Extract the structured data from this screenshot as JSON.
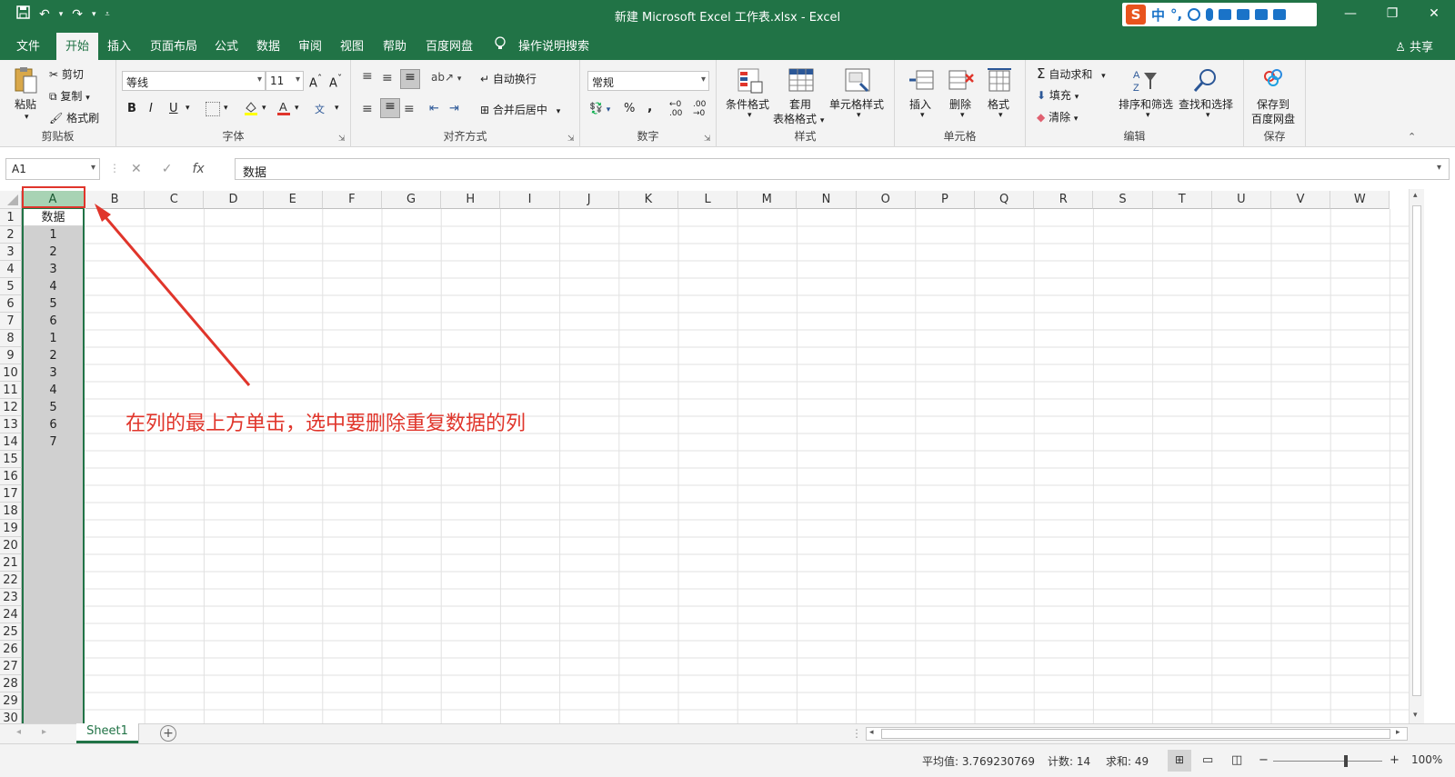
{
  "window": {
    "title": "新建 Microsoft Excel 工作表.xlsx  -  Excel",
    "controls": [
      "—",
      "❐",
      "✕"
    ]
  },
  "qat": {
    "save": "save-icon",
    "undo": "↶",
    "redo": "↷"
  },
  "ime": {
    "logo": "S",
    "mode": "中",
    "punct": "°,"
  },
  "tabs": [
    "文件",
    "开始",
    "插入",
    "页面布局",
    "公式",
    "数据",
    "审阅",
    "视图",
    "帮助",
    "百度网盘",
    "操作说明搜索"
  ],
  "share": "共享",
  "ribbon": {
    "clipboard": {
      "paste": "粘贴",
      "cut": "剪切",
      "copy": "复制",
      "format_painter": "格式刷",
      "label": "剪贴板"
    },
    "font": {
      "name": "等线",
      "size": "11",
      "bold": "B",
      "italic": "I",
      "underline": "U",
      "label": "字体"
    },
    "align": {
      "wrap": "自动换行",
      "merge": "合并后居中",
      "label": "对齐方式"
    },
    "number": {
      "format": "常规",
      "percent": "%",
      "comma": ",",
      "label": "数字"
    },
    "styles": {
      "conditional": "条件格式",
      "table_fmt_1": "套用",
      "table_fmt_2": "表格格式",
      "cell_styles": "单元格样式",
      "label": "样式"
    },
    "cells": {
      "insert": "插入",
      "delete": "删除",
      "format": "格式",
      "label": "单元格"
    },
    "editing": {
      "autosum": "自动求和",
      "fill": "填充",
      "clear": "清除",
      "sort": "排序和筛选",
      "find": "查找和选择",
      "label": "编辑"
    },
    "save": {
      "line1": "保存到",
      "line2": "百度网盘",
      "label": "保存"
    }
  },
  "formula_bar": {
    "name_box": "A1",
    "cancel": "✕",
    "enter": "✓",
    "fx": "fx",
    "content": "数据"
  },
  "columns": [
    "A",
    "B",
    "C",
    "D",
    "E",
    "F",
    "G",
    "H",
    "I",
    "J",
    "K",
    "L",
    "M",
    "N",
    "O",
    "P",
    "Q",
    "R",
    "S",
    "T",
    "U",
    "V",
    "W"
  ],
  "rows": [
    "1",
    "2",
    "3",
    "4",
    "5",
    "6",
    "7",
    "8",
    "9",
    "10",
    "11",
    "12",
    "13",
    "14",
    "15",
    "16",
    "17",
    "18",
    "19",
    "20",
    "21",
    "22",
    "23",
    "24",
    "25",
    "26",
    "27",
    "28",
    "29",
    "30"
  ],
  "column_a_values": [
    "数据",
    "1",
    "2",
    "3",
    "4",
    "5",
    "6",
    "1",
    "2",
    "3",
    "4",
    "5",
    "6",
    "7"
  ],
  "annotation": "在列的最上方单击，选中要删除重复数据的列",
  "sheet_tabs": [
    "Sheet1"
  ],
  "status_bar": {
    "average": "平均值: 3.769230769",
    "count": "计数: 14",
    "sum": "求和: 49",
    "zoom": "100%"
  },
  "colors": {
    "excel_green": "#217346",
    "annotation_red": "#e0352b"
  }
}
